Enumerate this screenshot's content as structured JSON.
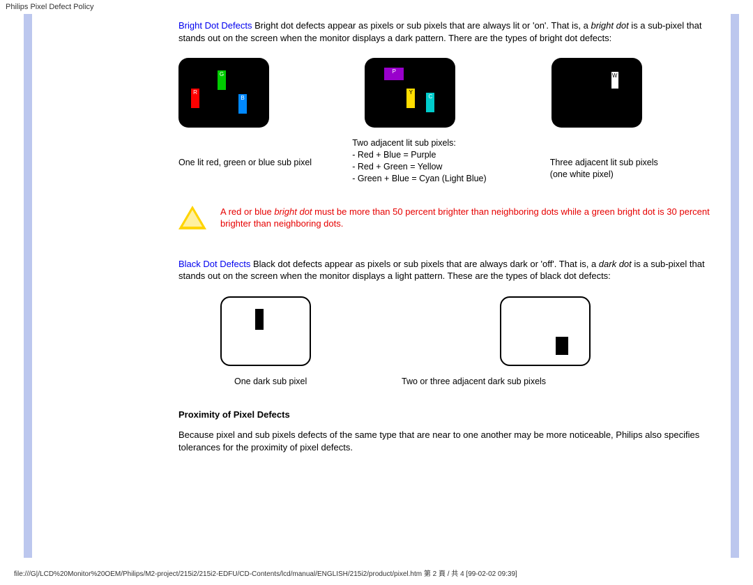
{
  "header": {
    "title": "Philips Pixel Defect Policy"
  },
  "bright": {
    "heading": "Bright Dot Defects",
    "body_before": " Bright dot defects appear as pixels or sub pixels that are always lit or 'on'. That is, a ",
    "italic": "bright dot",
    "body_after": " is a sub-pixel that stands out on the screen when the monitor displays a dark pattern. There are the types of bright dot defects:",
    "diag1": {
      "r": "R",
      "g": "G",
      "b": "B"
    },
    "diag2": {
      "p": "P",
      "y": "Y",
      "c": "C"
    },
    "diag3": {
      "w": "W"
    },
    "caption1": "One lit red, green or blue sub pixel",
    "caption2_l1": "Two adjacent lit sub pixels:",
    "caption2_l2": "- Red + Blue = Purple",
    "caption2_l3": "- Red + Green = Yellow",
    "caption2_l4": "- Green + Blue = Cyan (Light Blue)",
    "caption3_l1": "Three adjacent lit sub pixels",
    "caption3_l2": "(one white pixel)"
  },
  "warning": {
    "part1": "A red or blue ",
    "italic": "bright dot",
    "part2": " must be more than 50 percent brighter than neighboring dots while a green bright dot is 30 percent brighter than neighboring dots."
  },
  "black": {
    "heading": "Black Dot Defects",
    "body_before": " Black dot defects appear as pixels or sub pixels that are always dark or 'off'. That is, a ",
    "italic": "dark dot",
    "body_after": " is a sub-pixel that stands out on the screen when the monitor displays a light pattern. These are the types of black dot defects:",
    "caption1": "One dark sub pixel",
    "caption2": "Two or three adjacent dark sub pixels"
  },
  "proximity": {
    "heading": "Proximity of Pixel Defects",
    "body": "Because pixel and sub pixels defects of the same type that are near to one another may be more noticeable, Philips also specifies tolerances for the proximity of pixel defects."
  },
  "footer": "file:///G|/LCD%20Monitor%20OEM/Philips/M2-project/215i2/215i2-EDFU/CD-Contents/lcd/manual/ENGLISH/215i2/product/pixel.htm 第 2 頁 / 共 4  [99-02-02 09:39]"
}
